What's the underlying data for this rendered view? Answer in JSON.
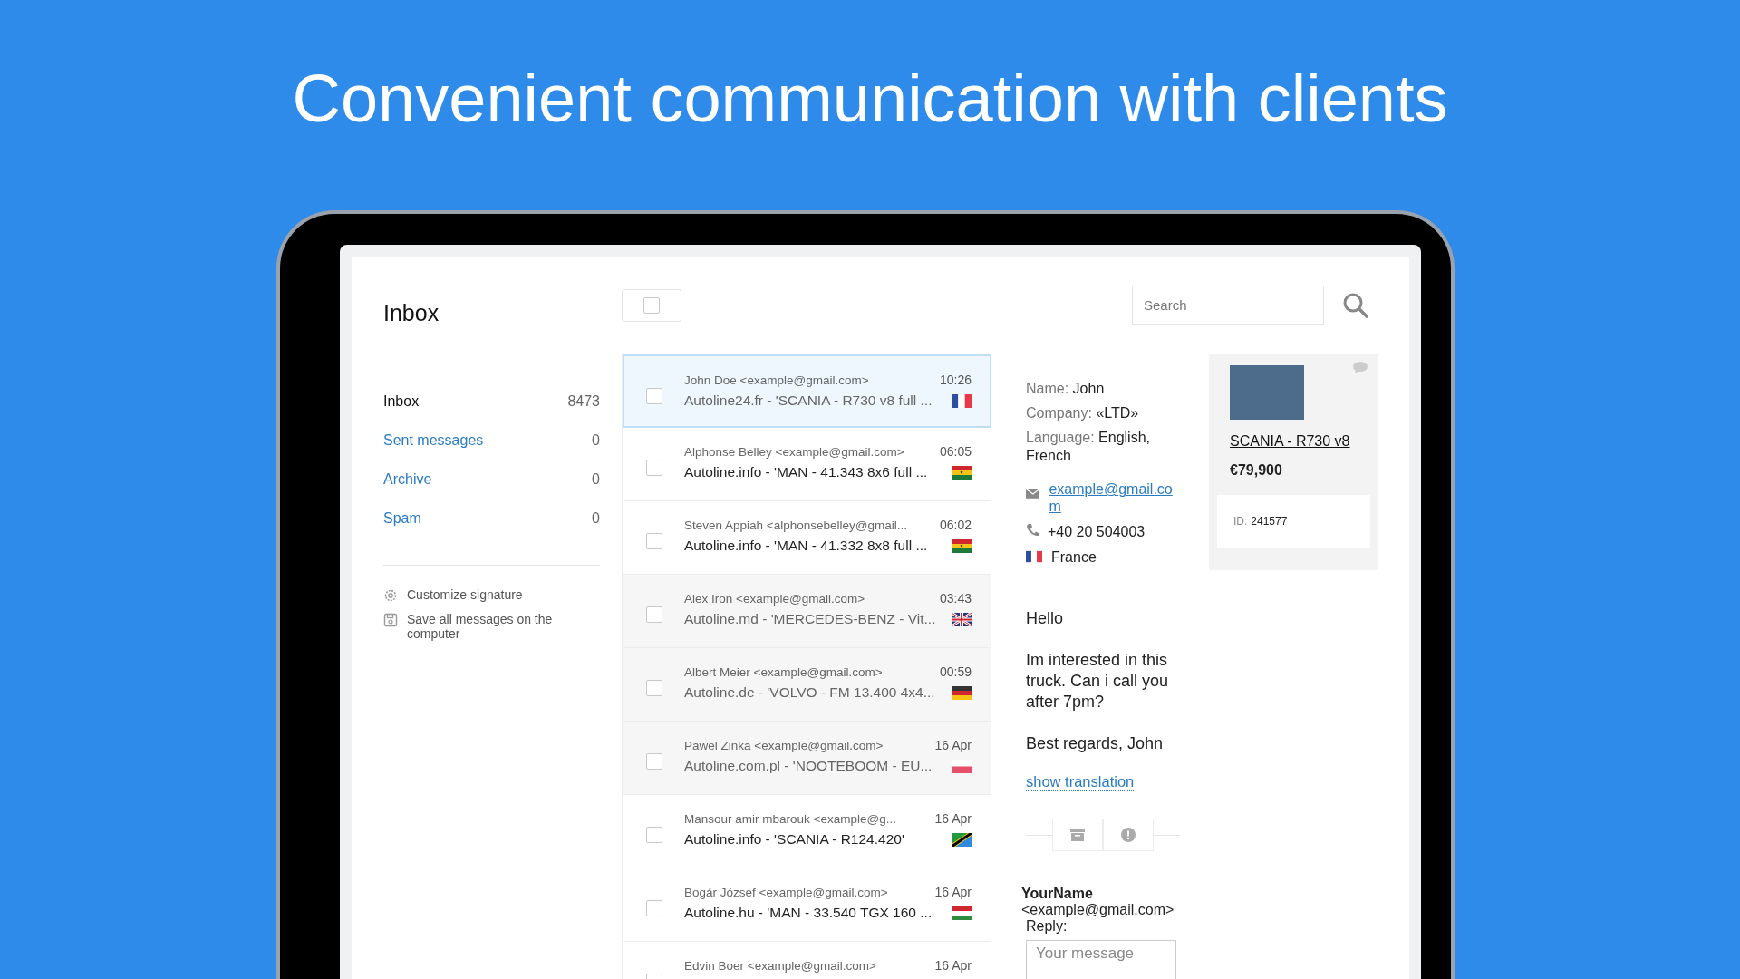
{
  "headline": "Convenient communication with clients",
  "inbox": {
    "title": "Inbox",
    "select_all": {
      "checked": false
    },
    "search": {
      "placeholder": "Search"
    }
  },
  "folders": [
    {
      "label": "Inbox",
      "count": "8473",
      "selected": true
    },
    {
      "label": "Sent messages",
      "count": "0",
      "selected": false
    },
    {
      "label": "Archive",
      "count": "0",
      "selected": false
    },
    {
      "label": "Spam",
      "count": "0",
      "selected": false
    }
  ],
  "tools": [
    {
      "label": "Customize signature",
      "kind": "gear"
    },
    {
      "label": "Save all messages on the computer",
      "kind": "save"
    }
  ],
  "messages": [
    {
      "sender": "John Doe <example@gmail.com>",
      "subject": "Autoline24.fr - 'SCANIA - R730 v8 full ...",
      "time": "10:26",
      "kind": "fr",
      "selected": true,
      "read": true,
      "checked": false
    },
    {
      "sender": "Alphonse Belley <example@gmail.com>",
      "subject": "Autoline.info - 'MAN - 41.343 8x6 full ...",
      "time": "06:05",
      "kind": "gh",
      "selected": false,
      "read": false,
      "checked": false
    },
    {
      "sender": "Steven Appiah <alphonsebelley@gmail...",
      "subject": "Autoline.info - 'MAN - 41.332 8x8 full ...",
      "time": "06:02",
      "kind": "gh",
      "selected": false,
      "read": false,
      "checked": false
    },
    {
      "sender": "Alex Iron <example@gmail.com>",
      "subject": "Autoline.md - 'MERCEDES-BENZ - Vit...",
      "time": "03:43",
      "kind": "gb",
      "selected": false,
      "read": true,
      "checked": false
    },
    {
      "sender": "Albert Meier <example@gmail.com>",
      "subject": "Autoline.de - 'VOLVO - FM 13.400 4x4...",
      "time": "00:59",
      "kind": "de",
      "selected": false,
      "read": true,
      "checked": false
    },
    {
      "sender": "Pawel Zinka <example@gmail.com>",
      "subject": "Autoline.com.pl - 'NOOTEBOOM - EU...",
      "time": "16 Apr",
      "kind": "pl",
      "selected": false,
      "read": true,
      "checked": false
    },
    {
      "sender": "Mansour amir mbarouk <example@g...",
      "subject": "Autoline.info - 'SCANIA - R124.420'",
      "time": "16 Apr",
      "kind": "tz",
      "selected": false,
      "read": false,
      "checked": false
    },
    {
      "sender": "Bogár József <example@gmail.com>",
      "subject": "Autoline.hu - 'MAN - 33.540 TGX 160 ...",
      "time": "16 Apr",
      "kind": "hu",
      "selected": false,
      "read": false,
      "checked": false
    },
    {
      "sender": "Edvin Boer <example@gmail.com>",
      "time": "16 Apr",
      "selected": false,
      "checked": false
    }
  ],
  "contact": {
    "fields": [
      {
        "label": "Name:",
        "value": "John"
      },
      {
        "label": "Company:",
        "value": "«LTD»"
      },
      {
        "label": "Language:",
        "value": "English, French"
      }
    ],
    "email": "example@gmail.com",
    "phone": "+40 20 504003",
    "country": {
      "name": "France",
      "kind": "fr"
    }
  },
  "message": {
    "paragraphs": [
      "Hello",
      "Im interested in this truck. Can i call you after 7pm?",
      "Best regards, John"
    ],
    "translation_link": "show translation"
  },
  "reply": {
    "name": "YourName",
    "email": "<example@gmail.com>",
    "label": "Reply:",
    "placeholder": "Your message"
  },
  "product": {
    "title": "SCANIA - R730 v8",
    "price": "€79,900",
    "id_label": "ID:",
    "id": "241577"
  }
}
